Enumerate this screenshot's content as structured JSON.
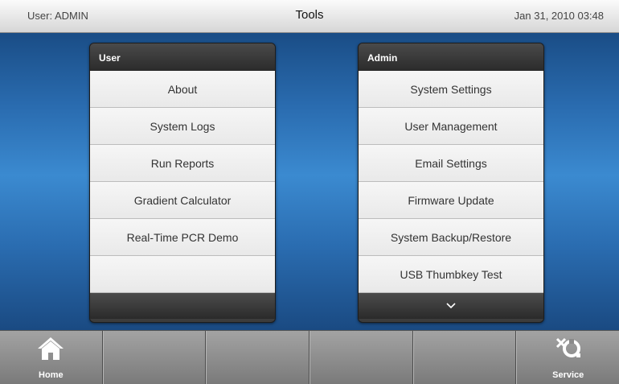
{
  "header": {
    "user": "User: ADMIN",
    "title": "Tools",
    "datetime": "Jan 31, 2010 03:48"
  },
  "user_panel": {
    "title": "User",
    "items": [
      {
        "label": "About"
      },
      {
        "label": "System Logs"
      },
      {
        "label": "Run Reports"
      },
      {
        "label": "Gradient Calculator"
      },
      {
        "label": "Real-Time PCR Demo"
      },
      {
        "label": ""
      }
    ]
  },
  "admin_panel": {
    "title": "Admin",
    "items": [
      {
        "label": "System Settings"
      },
      {
        "label": "User Management"
      },
      {
        "label": "Email Settings"
      },
      {
        "label": "Firmware Update"
      },
      {
        "label": "System Backup/Restore"
      },
      {
        "label": "USB Thumbkey Test"
      }
    ],
    "scroll_icon": "chevron-down-icon"
  },
  "bottom_nav": [
    {
      "label": "Home",
      "icon": "home-icon"
    },
    {
      "label": "",
      "icon": ""
    },
    {
      "label": "",
      "icon": ""
    },
    {
      "label": "",
      "icon": ""
    },
    {
      "label": "",
      "icon": ""
    },
    {
      "label": "Service",
      "icon": "service-icon"
    }
  ]
}
